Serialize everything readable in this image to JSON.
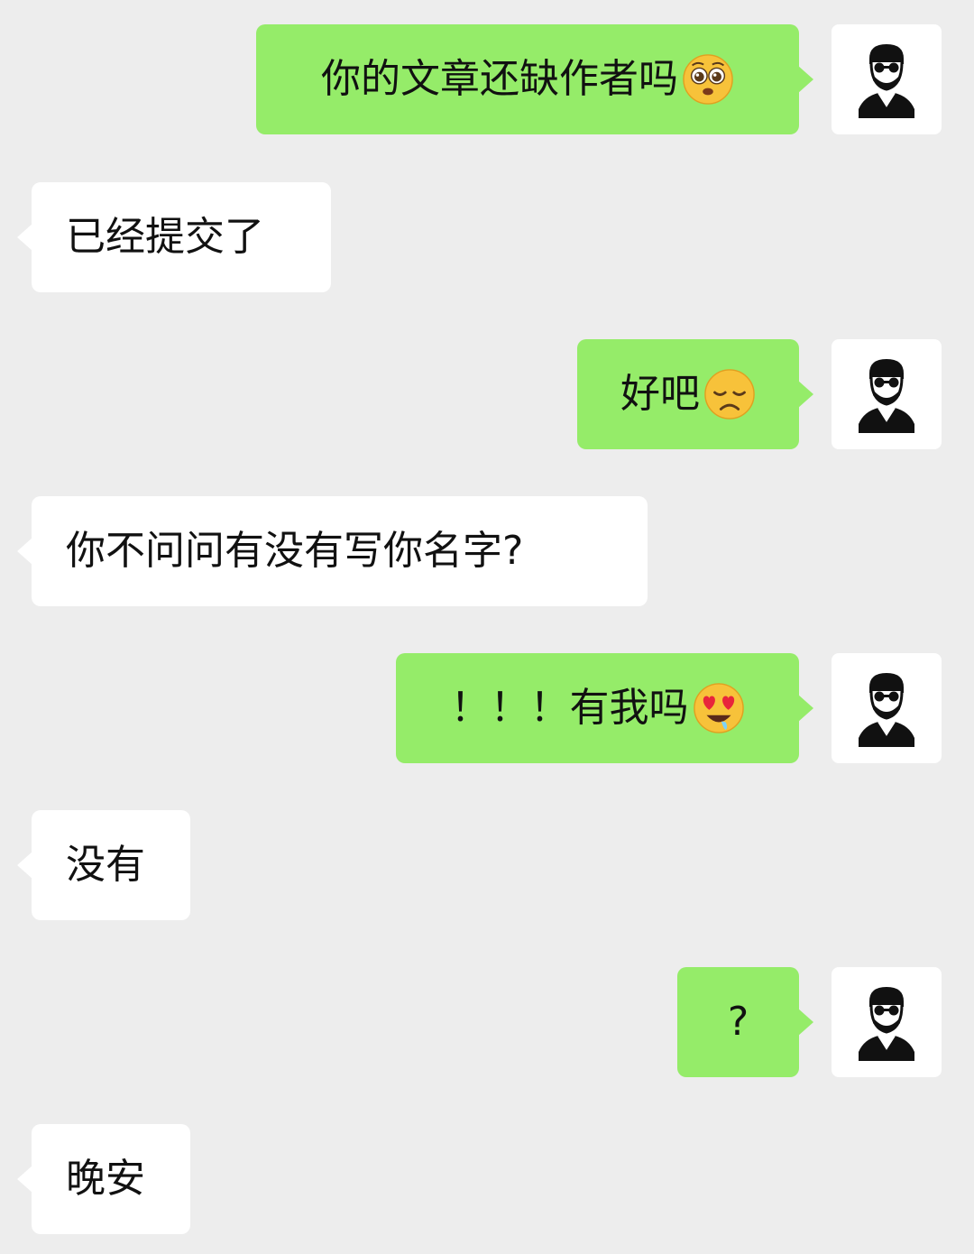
{
  "messages": [
    {
      "side": "out",
      "text": "你的文章还缺作者吗",
      "emoji": "pleading-face-icon"
    },
    {
      "side": "in",
      "text": "已经提交了"
    },
    {
      "side": "out",
      "text": "好吧",
      "emoji": "disappointed-face-icon"
    },
    {
      "side": "in",
      "text": "你不问问有没有写你名字?"
    },
    {
      "side": "out",
      "text": "！！！有我吗",
      "emoji": "heart-eyes-drooling-face-icon"
    },
    {
      "side": "in",
      "text": "没有"
    },
    {
      "side": "out",
      "text": "?"
    },
    {
      "side": "in",
      "text": "晚安"
    }
  ],
  "colors": {
    "background": "#ededed",
    "outgoing_bubble": "#95ec69",
    "incoming_bubble": "#ffffff",
    "text": "#111111"
  }
}
